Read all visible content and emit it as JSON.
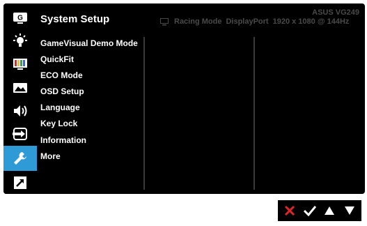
{
  "header": {
    "title": "System Setup",
    "model": "ASUS  VG249",
    "status": {
      "mode": "Racing Mode",
      "input": "DisplayPort",
      "resolution": "1920 x 1080 @ 144Hz"
    }
  },
  "sidebar": {
    "items": [
      {
        "icon": "gamevisual-icon",
        "active": false
      },
      {
        "icon": "blue-light-filter-icon",
        "active": false
      },
      {
        "icon": "color-icon",
        "active": false
      },
      {
        "icon": "image-icon",
        "active": false
      },
      {
        "icon": "sound-icon",
        "active": false
      },
      {
        "icon": "input-select-icon",
        "active": false
      },
      {
        "icon": "system-setup-wrench-icon",
        "active": true
      },
      {
        "icon": "shortcut-icon",
        "active": false
      }
    ]
  },
  "menu": {
    "items": [
      "GameVisual Demo Mode",
      "QuickFit",
      "ECO Mode",
      "OSD Setup",
      "Language",
      "Key Lock",
      "Information",
      "More"
    ]
  },
  "footer": {
    "buttons": [
      "close-icon",
      "confirm-check-icon",
      "up-arrow-icon",
      "down-arrow-icon"
    ]
  },
  "colors": {
    "accent": "#2e9bd6",
    "close_red": "#e0262c",
    "background": "#000000",
    "status_text": "#4a4a4a"
  }
}
